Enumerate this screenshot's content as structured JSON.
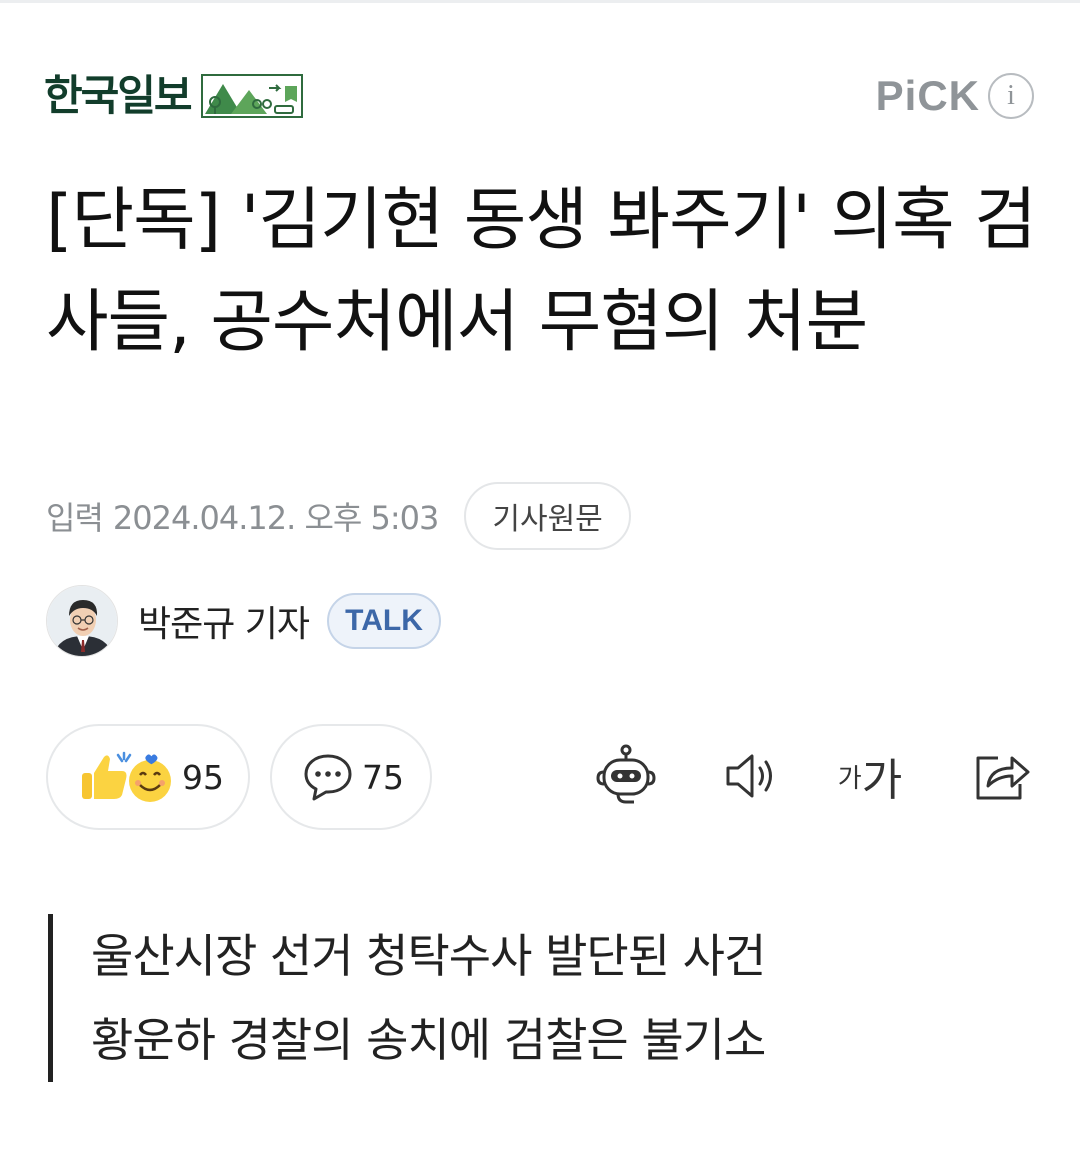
{
  "header": {
    "press_name": "한국일보",
    "pick_label": "PiCK",
    "pick_info_icon": "i"
  },
  "article": {
    "title": "[단독] '김기현 동생 봐주기' 의혹 검사들, 공수처에서 무혐의 처분",
    "input_label": "입력",
    "input_date": "2024.04.12. 오후 5:03",
    "origin_button": "기사원문",
    "reporter": "박준규 기자",
    "talk_button": "TALK",
    "summary": [
      "울산시장 선거 청탁수사 발단된 사건",
      "황운하 경찰의 송치에 검찰은 불기소"
    ]
  },
  "actions": {
    "reaction_count": "95",
    "comment_count": "75",
    "font_small": "가",
    "font_large": "가"
  },
  "icons": {
    "reaction": "thumbs-up-smile-icon",
    "comment": "speech-bubble-icon",
    "summary_bot": "robot-icon",
    "tts": "speaker-icon",
    "font_size": "font-size-icon",
    "share": "share-icon"
  },
  "colors": {
    "press_green": "#123d2b",
    "talk_blue": "#3c67a8",
    "meta_gray": "#8b8f93"
  }
}
